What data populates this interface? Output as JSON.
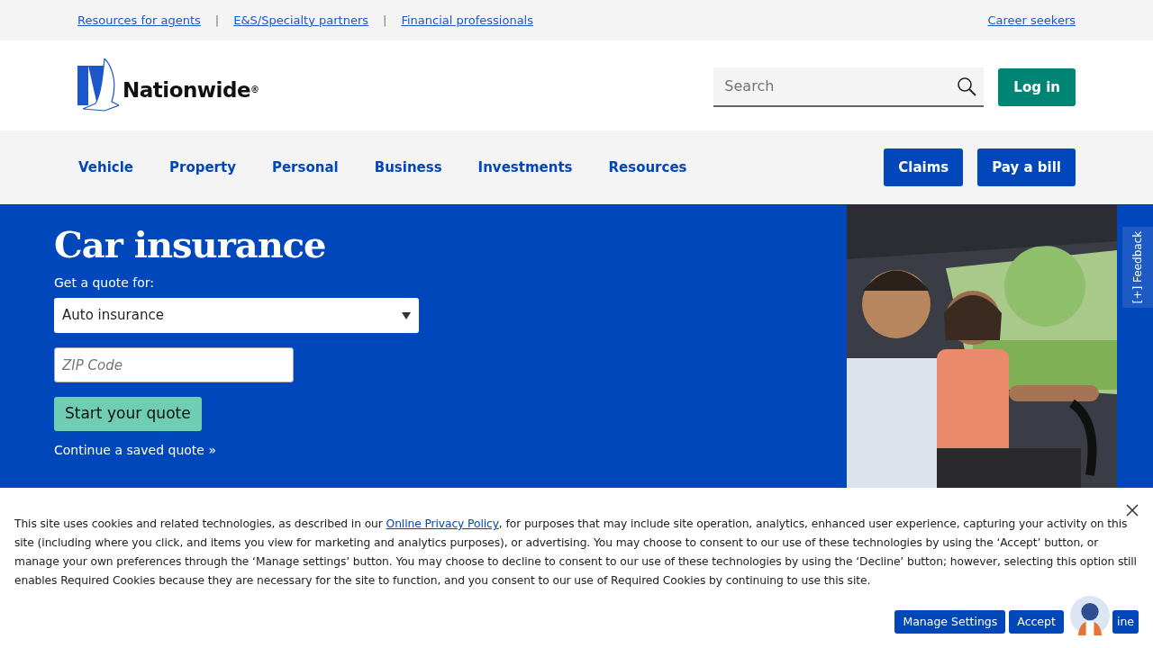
{
  "utility_links": [
    {
      "label": "Resources for agents"
    },
    {
      "label": "E&S/Specialty partners"
    },
    {
      "label": "Financial professionals"
    }
  ],
  "utility_separator": "|",
  "career_link": "Career seekers",
  "logo": {
    "text": "Nationwide",
    "mark": "®"
  },
  "search": {
    "placeholder": "Search"
  },
  "login_button": "Log in",
  "nav_items": [
    "Vehicle",
    "Property",
    "Personal",
    "Business",
    "Investments",
    "Resources"
  ],
  "nav_buttons": [
    "Claims",
    "Pay a bill"
  ],
  "hero": {
    "title": "Car insurance",
    "quote_label": "Get a quote for:",
    "product_select": "Auto insurance",
    "zip": {
      "placeholder": "ZIP Code"
    },
    "start_button": "Start your quote",
    "saved_link": "Continue a saved quote »"
  },
  "feedback_tab": "[+] Feedback",
  "cookie_banner": {
    "text_before": "This site uses cookies and related technologies, as described in our ",
    "link": "Online Privacy Policy",
    "text_after": ", for purposes that may include site operation, analytics, enhanced user experience, capturing your activity on this site (including where you click, and items you view for marketing and analytics purposes), or advertising. You may choose to consent to our use of these technologies by using the ‘Accept’ button, or manage your own preferences through the ‘Manage settings’ button. You may choose to decline to consent to our use of these technologies by using the ‘Decline’ button; however, selecting this option still enables Required Cookies because they are necessary for the site to function, and you consent to our use of Required Cookies by continuing to use this site.",
    "buttons": [
      "Manage Settings",
      "Accept",
      "ine"
    ]
  }
}
